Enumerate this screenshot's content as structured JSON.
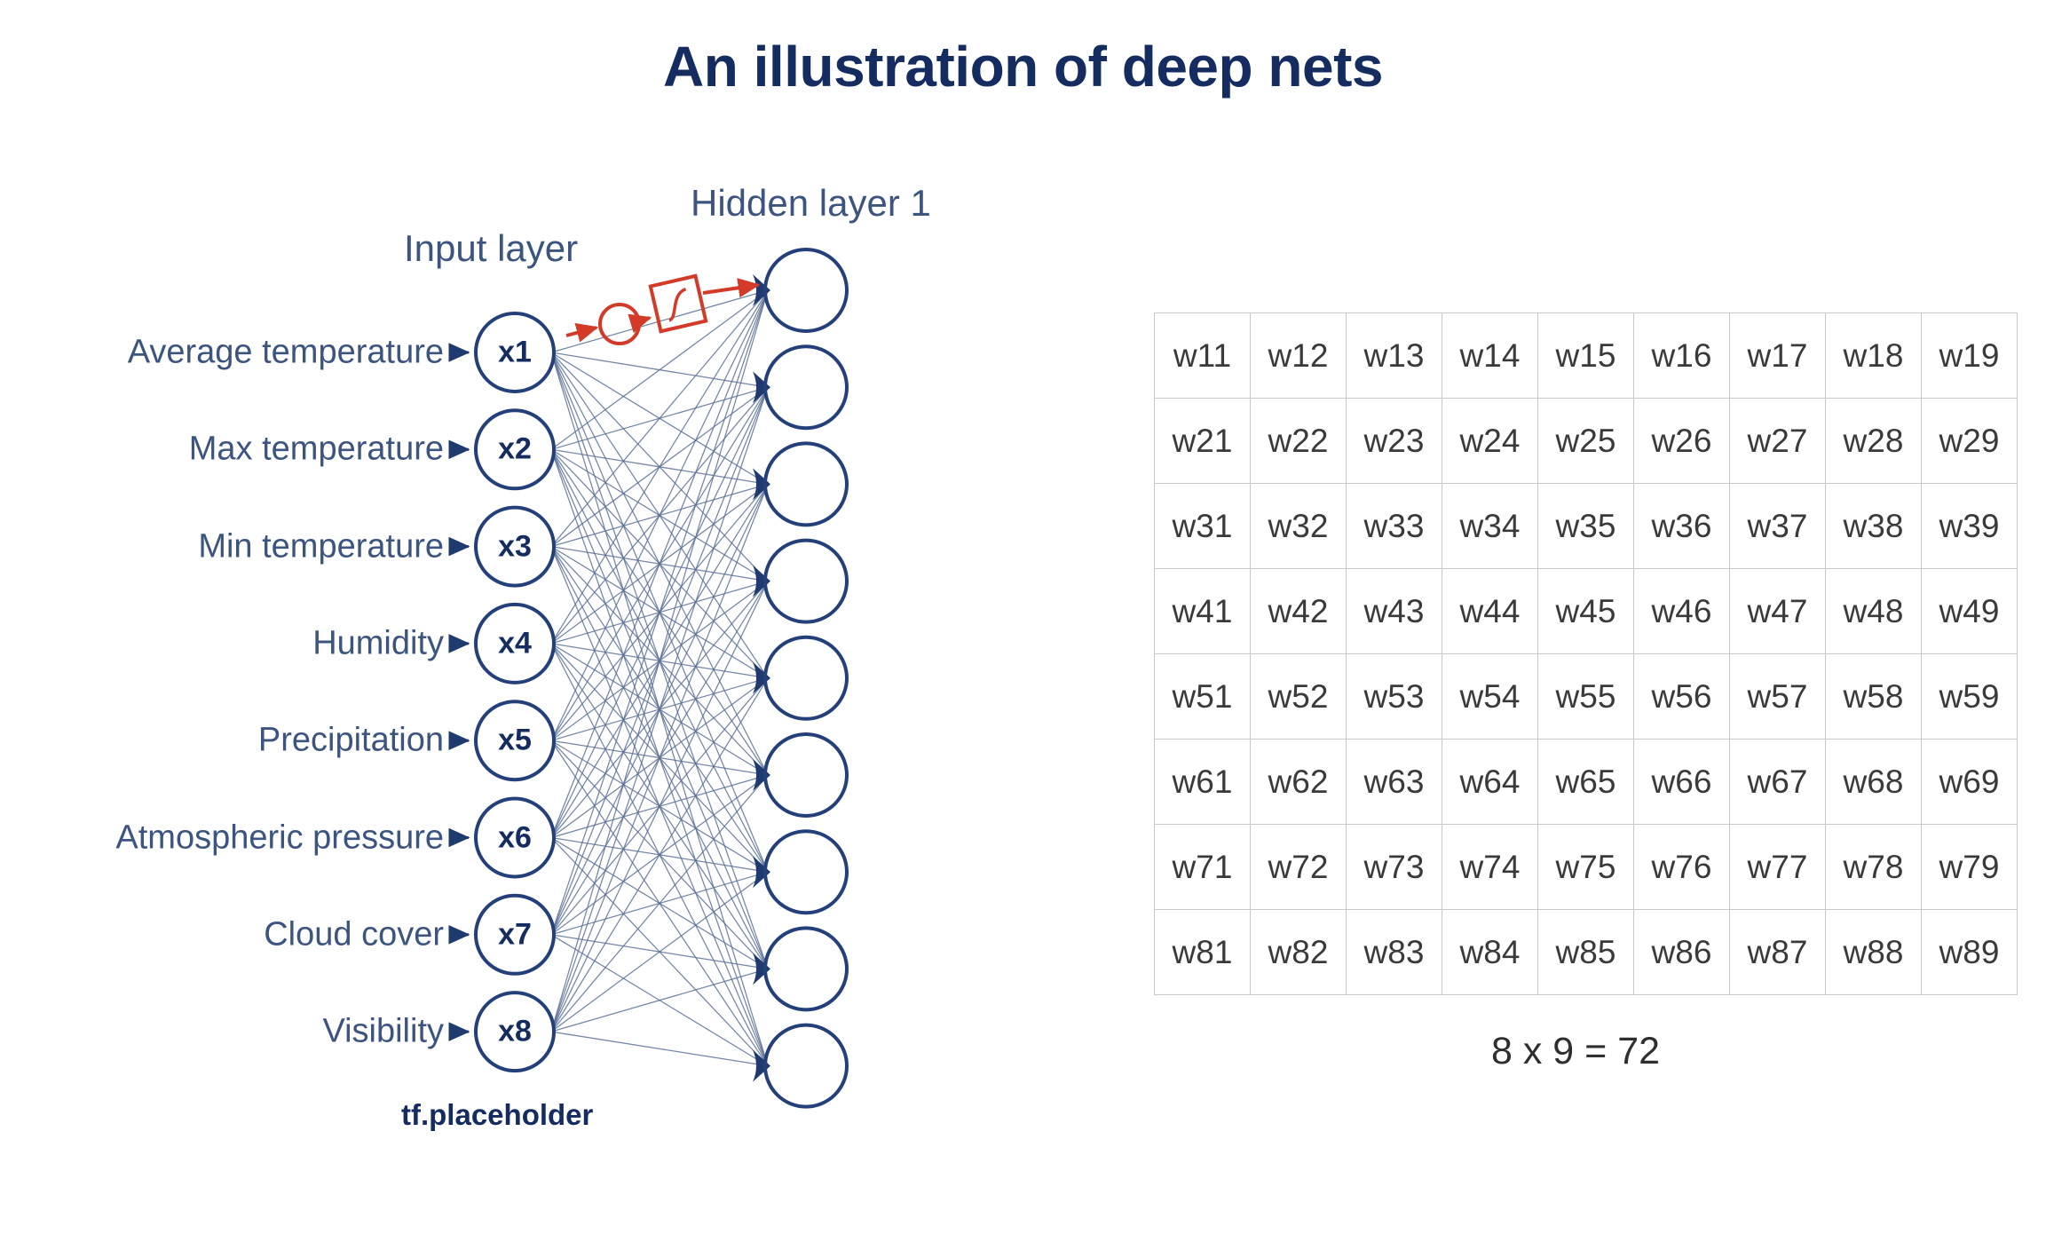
{
  "title": "An illustration of deep nets",
  "colors": {
    "title": "#152C61",
    "label": "#3C5480",
    "node_stroke": "#23407A",
    "edge": "#5B7096",
    "annotation_red": "#D43A28",
    "table_border": "#c8c8c8",
    "table_text": "#3a3a3a",
    "background": "#ffffff"
  },
  "diagram": {
    "input_layer_caption": "Input layer",
    "hidden_layer_caption": "Hidden layer 1",
    "placeholder_label": "tf.placeholder",
    "input_features": [
      "Average temperature",
      "Max temperature",
      "Min temperature",
      "Humidity",
      "Precipitation",
      "Atmospheric pressure",
      "Cloud cover",
      "Visibility"
    ],
    "input_nodes": [
      "x1",
      "x2",
      "x3",
      "x4",
      "x5",
      "x6",
      "x7",
      "x8"
    ],
    "hidden_node_count": 9,
    "annotation": {
      "sum_node": "summation-circle",
      "activation_box": "sigmoid-activation",
      "icon_names": [
        "sum-circle-icon",
        "sigmoid-curve-icon",
        "red-arrow-icon"
      ]
    }
  },
  "weights": {
    "rows": [
      [
        "w11",
        "w12",
        "w13",
        "w14",
        "w15",
        "w16",
        "w17",
        "w18",
        "w19"
      ],
      [
        "w21",
        "w22",
        "w23",
        "w24",
        "w25",
        "w26",
        "w27",
        "w28",
        "w29"
      ],
      [
        "w31",
        "w32",
        "w33",
        "w34",
        "w35",
        "w36",
        "w37",
        "w38",
        "w39"
      ],
      [
        "w41",
        "w42",
        "w43",
        "w44",
        "w45",
        "w46",
        "w47",
        "w48",
        "w49"
      ],
      [
        "w51",
        "w52",
        "w53",
        "w54",
        "w55",
        "w56",
        "w57",
        "w58",
        "w59"
      ],
      [
        "w61",
        "w62",
        "w63",
        "w64",
        "w65",
        "w66",
        "w67",
        "w68",
        "w69"
      ],
      [
        "w71",
        "w72",
        "w73",
        "w74",
        "w75",
        "w76",
        "w77",
        "w78",
        "w79"
      ],
      [
        "w81",
        "w82",
        "w83",
        "w84",
        "w85",
        "w86",
        "w87",
        "w88",
        "w89"
      ]
    ],
    "equation": "8 x 9 = 72"
  }
}
